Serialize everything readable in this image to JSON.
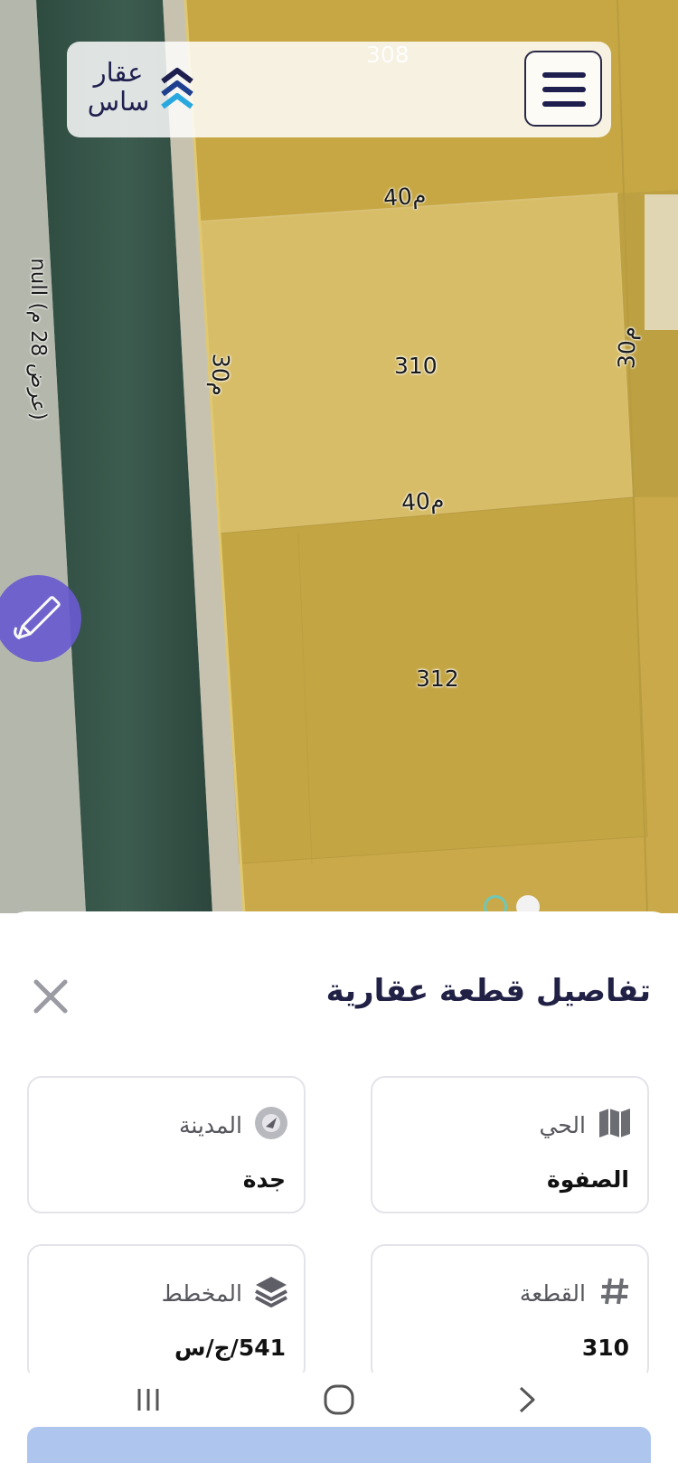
{
  "app": {
    "logo_line1": "عقار",
    "logo_line2": "ساس",
    "brand_color": "#1f1f4f",
    "accent_color": "#29a8e0"
  },
  "map": {
    "parcel_labels": [
      "308",
      "310",
      "312"
    ],
    "dimension_labels": {
      "top": "40م",
      "bottom": "40م",
      "left": "30م",
      "right": "30م"
    },
    "street_label": "null (عرض 28 م)",
    "parcel_fill": "#cfb04f",
    "selected_fill": "#d8bf6a",
    "road_color": "#3c5a4e"
  },
  "sheet": {
    "title": "تفاصيل قطعة عقارية",
    "cards": [
      {
        "label": "الحي",
        "value": "الصفوة",
        "icon": "map-icon"
      },
      {
        "label": "المدينة",
        "value": "جدة",
        "icon": "city-icon"
      },
      {
        "label": "القطعة",
        "value": "310",
        "icon": "hash-icon"
      },
      {
        "label": "المخطط",
        "value": "541/ج/س",
        "icon": "layers-icon"
      }
    ]
  },
  "navbar": {
    "icons": [
      "recent-apps-icon",
      "home-icon",
      "back-icon"
    ]
  }
}
